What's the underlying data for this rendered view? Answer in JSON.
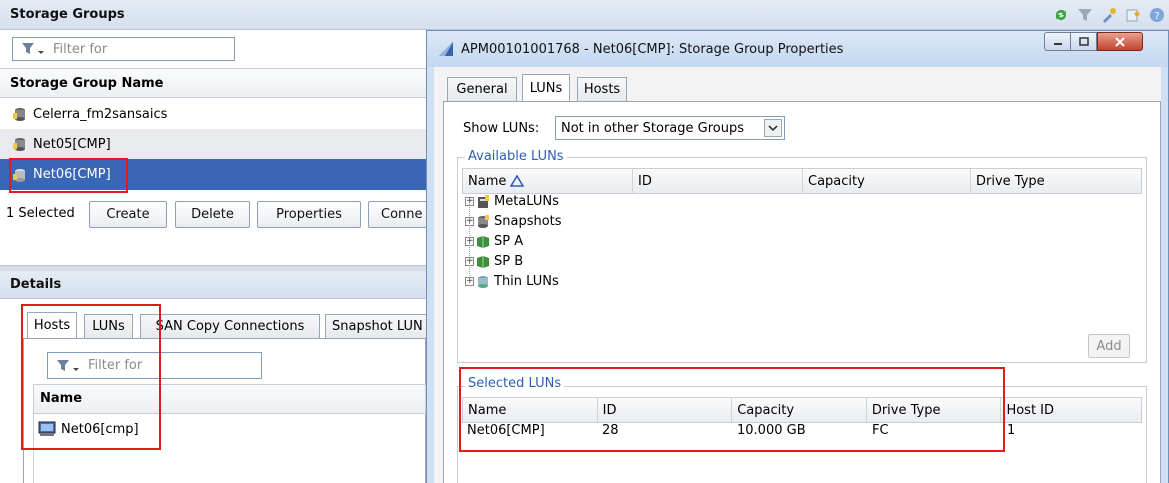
{
  "top_bar": {
    "title": "Storage Groups"
  },
  "left": {
    "filter_placeholder": "Filter for",
    "column_header": "Storage Group Name",
    "groups": [
      {
        "name": "Celerra_fm2sansaics"
      },
      {
        "name": "Net05[CMP]"
      },
      {
        "name": "Net06[CMP]"
      }
    ],
    "selected_count": "1 Selected",
    "buttons": {
      "create": "Create",
      "delete": "Delete",
      "properties": "Properties",
      "connect": "Conne"
    },
    "details": {
      "title": "Details",
      "tabs": [
        "Hosts",
        "LUNs",
        "SAN Copy Connections",
        "Snapshot LUN"
      ],
      "filter_placeholder": "Filter for",
      "column_header": "Name",
      "hosts": [
        "Net06[cmp]"
      ]
    }
  },
  "dialog": {
    "title": "APM00101001768 - Net06[CMP]: Storage Group Properties",
    "tabs": [
      "General",
      "LUNs",
      "Hosts"
    ],
    "show_luns_label": "Show LUNs:",
    "show_luns_value": "Not in other Storage Groups",
    "available": {
      "legend": "Available LUNs",
      "columns": [
        "Name",
        "ID",
        "Capacity",
        "Drive Type"
      ],
      "tree": [
        "MetaLUNs",
        "Snapshots",
        "SP A",
        "SP B",
        "Thin LUNs"
      ],
      "add_label": "Add"
    },
    "selected": {
      "legend": "Selected LUNs",
      "columns": [
        "Name",
        "ID",
        "Capacity",
        "Drive Type",
        "Host ID"
      ],
      "rows": [
        {
          "name": "Net06[CMP]",
          "id": "28",
          "capacity": "10.000 GB",
          "drive_type": "FC",
          "host_id": "1"
        }
      ]
    }
  },
  "colors": {
    "selected_row": "#3a66b6",
    "highlight": "#e11b1b",
    "dialog_title_bar": "#cfe0f5"
  }
}
